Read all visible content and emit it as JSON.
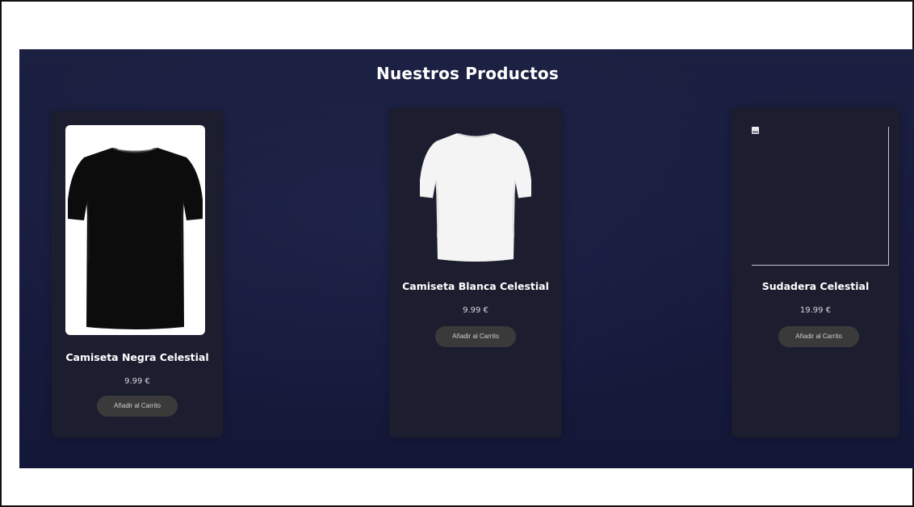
{
  "section": {
    "title": "Nuestros Productos"
  },
  "products": [
    {
      "name": "Camiseta Negra Celestial",
      "price": "9.99 €",
      "button_label": "Añadir al Carrito",
      "image": "black-tshirt"
    },
    {
      "name": "Camiseta Blanca Celestial",
      "price": "9.99 €",
      "button_label": "Añadir al Carrito",
      "image": "white-tshirt"
    },
    {
      "name": "Sudadera Celestial",
      "price": "19.99 €",
      "button_label": "Añadir al Carrito",
      "image": "broken-image-icon"
    }
  ],
  "colors": {
    "section_background": "#1b1f40",
    "card_background": "#1c1d2f",
    "button_background": "#3a3a3a",
    "text": "#ffffff"
  }
}
